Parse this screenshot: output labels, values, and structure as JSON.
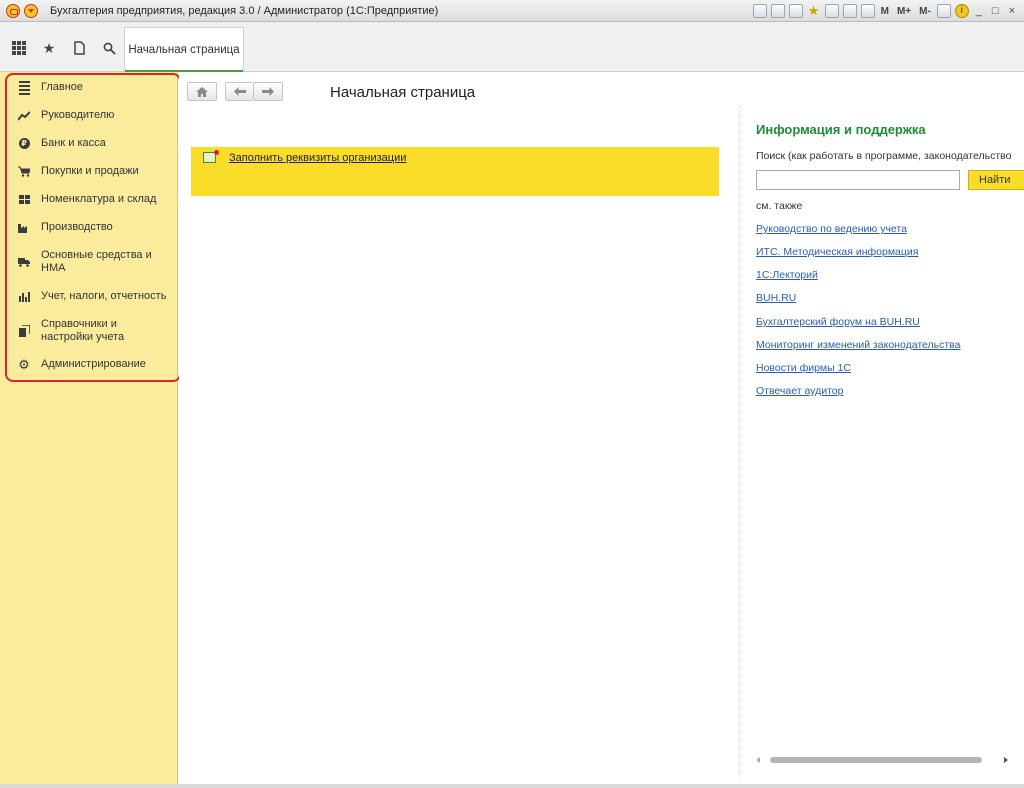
{
  "window": {
    "title": "Бухгалтерия предприятия, редакция 3.0 / Администратор  (1С:Предприятие)",
    "memory_buttons": [
      "M",
      "M+",
      "M-"
    ],
    "info_glyph": "i",
    "window_controls": [
      "_",
      "□",
      "×"
    ]
  },
  "tabs": [
    {
      "label": "Начальная страница",
      "active": true
    }
  ],
  "sidebar": {
    "items": [
      {
        "label": "Главное",
        "icon": "menu-icon"
      },
      {
        "label": "Руководителю",
        "icon": "trend-icon"
      },
      {
        "label": "Банк и касса",
        "icon": "coin-icon",
        "glyph": "₽"
      },
      {
        "label": "Покупки и продажи",
        "icon": "cart-icon"
      },
      {
        "label": "Номенклатура и склад",
        "icon": "grid-icon"
      },
      {
        "label": "Производство",
        "icon": "factory-icon"
      },
      {
        "label": "Основные средства и НМА",
        "icon": "truck-icon"
      },
      {
        "label": "Учет, налоги, отчетность",
        "icon": "bar-chart-icon"
      },
      {
        "label": "Справочники и настройки учета",
        "icon": "books-icon"
      },
      {
        "label": "Администрирование",
        "icon": "gear-icon"
      }
    ]
  },
  "main": {
    "title": "Начальная страница",
    "banner_link": "Заполнить реквизиты организации"
  },
  "info": {
    "title": "Информация и поддержка",
    "search_label": "Поиск (как работать в программе, законодательство",
    "search_value": "",
    "find_button": "Найти",
    "see_also": "см. также",
    "links": [
      "Руководство по ведению учета",
      "ИТС. Методическая информация",
      "1С:Лекторий",
      "BUH.RU",
      "Бухгалтерский форум на BUH.RU",
      "Мониторинг изменений законодательства",
      "Новости фирмы 1С",
      "Отвечает аудитор"
    ]
  },
  "colors": {
    "sidebar_bg": "#fbec9d",
    "banner_bg": "#f9dd29",
    "accent_green": "#1f8a3a",
    "link_blue": "#2a5db0",
    "highlight_red": "#d9262c"
  }
}
